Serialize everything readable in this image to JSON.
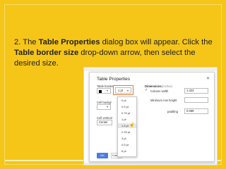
{
  "slide": {
    "instruction": {
      "p1": "2. The ",
      "b1": "Table Properties",
      "p2": " dialog box will appear. Click the ",
      "b2": "Table border size",
      "p3": " drop-down arrow, then select the desired size."
    }
  },
  "dialog": {
    "title": "Table Properties",
    "table_border_label": "Table border",
    "border_size_value": "1 pt",
    "cell_background_label": "Cell backgr",
    "cell_vertical_label": "Cell vertical",
    "vertical_value": "Center",
    "dimensions_label": "Dimensions",
    "dimensions_unit": "(inches)",
    "column_width_label": "Column width",
    "column_width_value": "1.323",
    "min_row_height_label": "Minimum row height",
    "cell_padding_label": "padding",
    "cell_padding_value": "0.069",
    "ok_label": "OK",
    "cancel_label": "Cancel",
    "border_sizes": [
      "0 pt",
      "0.5 pt",
      "0.75 pt",
      "1 pt",
      "1.5 pt",
      "2.25 pt",
      "3 pt",
      "4.5 pt",
      "6 pt"
    ],
    "hovered_size": "1.5 pt"
  },
  "colors": {
    "slide_bg": "#f5c518",
    "highlight": "#e07a30",
    "ok_button": "#4a7de0"
  }
}
